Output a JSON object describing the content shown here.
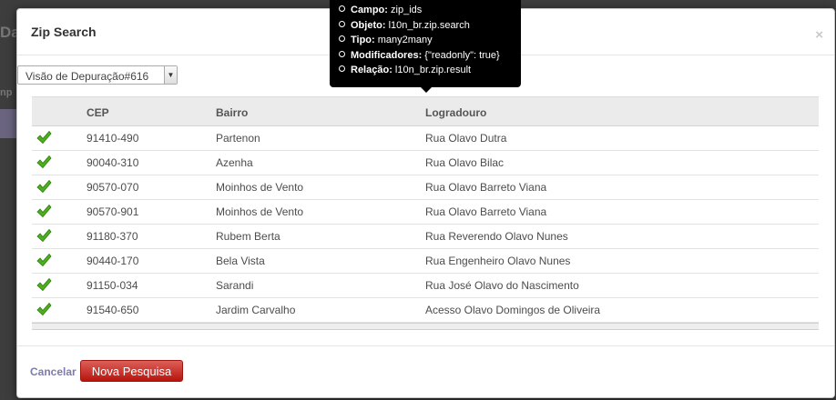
{
  "background": {
    "fragment_title": "Da",
    "fragment_label": "np"
  },
  "modal": {
    "title": "Zip Search",
    "close_glyph": "×",
    "view_select": {
      "value": "Visão de Depuração#616"
    },
    "columns": [
      "CEP",
      "Bairro",
      "Logradouro"
    ],
    "rows": [
      {
        "cep": "91410-490",
        "bairro": "Partenon",
        "logradouro": "Rua Olavo Dutra"
      },
      {
        "cep": "90040-310",
        "bairro": "Azenha",
        "logradouro": "Rua Olavo Bilac"
      },
      {
        "cep": "90570-070",
        "bairro": "Moinhos de Vento",
        "logradouro": "Rua Olavo Barreto Viana"
      },
      {
        "cep": "90570-901",
        "bairro": "Moinhos de Vento",
        "logradouro": "Rua Olavo Barreto Viana"
      },
      {
        "cep": "91180-370",
        "bairro": "Rubem Berta",
        "logradouro": "Rua Reverendo Olavo Nunes"
      },
      {
        "cep": "90440-170",
        "bairro": "Bela Vista",
        "logradouro": "Rua Engenheiro Olavo Nunes"
      },
      {
        "cep": "91150-034",
        "bairro": "Sarandi",
        "logradouro": "Rua José Olavo do Nascimento"
      },
      {
        "cep": "91540-650",
        "bairro": "Jardim Carvalho",
        "logradouro": "Acesso Olavo Domingos de Oliveira"
      }
    ],
    "footer": {
      "cancel_label": "Cancelar",
      "new_search_label": "Nova Pesquisa"
    }
  },
  "tooltip": {
    "lines": [
      {
        "key": "Campo:",
        "value": "zip_ids"
      },
      {
        "key": "Objeto:",
        "value": "l10n_br.zip.search"
      },
      {
        "key": "Tipo:",
        "value": "many2many"
      },
      {
        "key": "Modificadores:",
        "value": "{\"readonly\": true}"
      },
      {
        "key": "Relação:",
        "value": "l10n_br.zip.result"
      }
    ]
  },
  "icons": {
    "row_select": "checkmark-icon",
    "dropdown": "dropdown-arrow-icon",
    "close": "close-icon"
  },
  "colors": {
    "check": "#4caf1e",
    "button": "#c9271f",
    "cancel_link": "#7c7bad"
  }
}
